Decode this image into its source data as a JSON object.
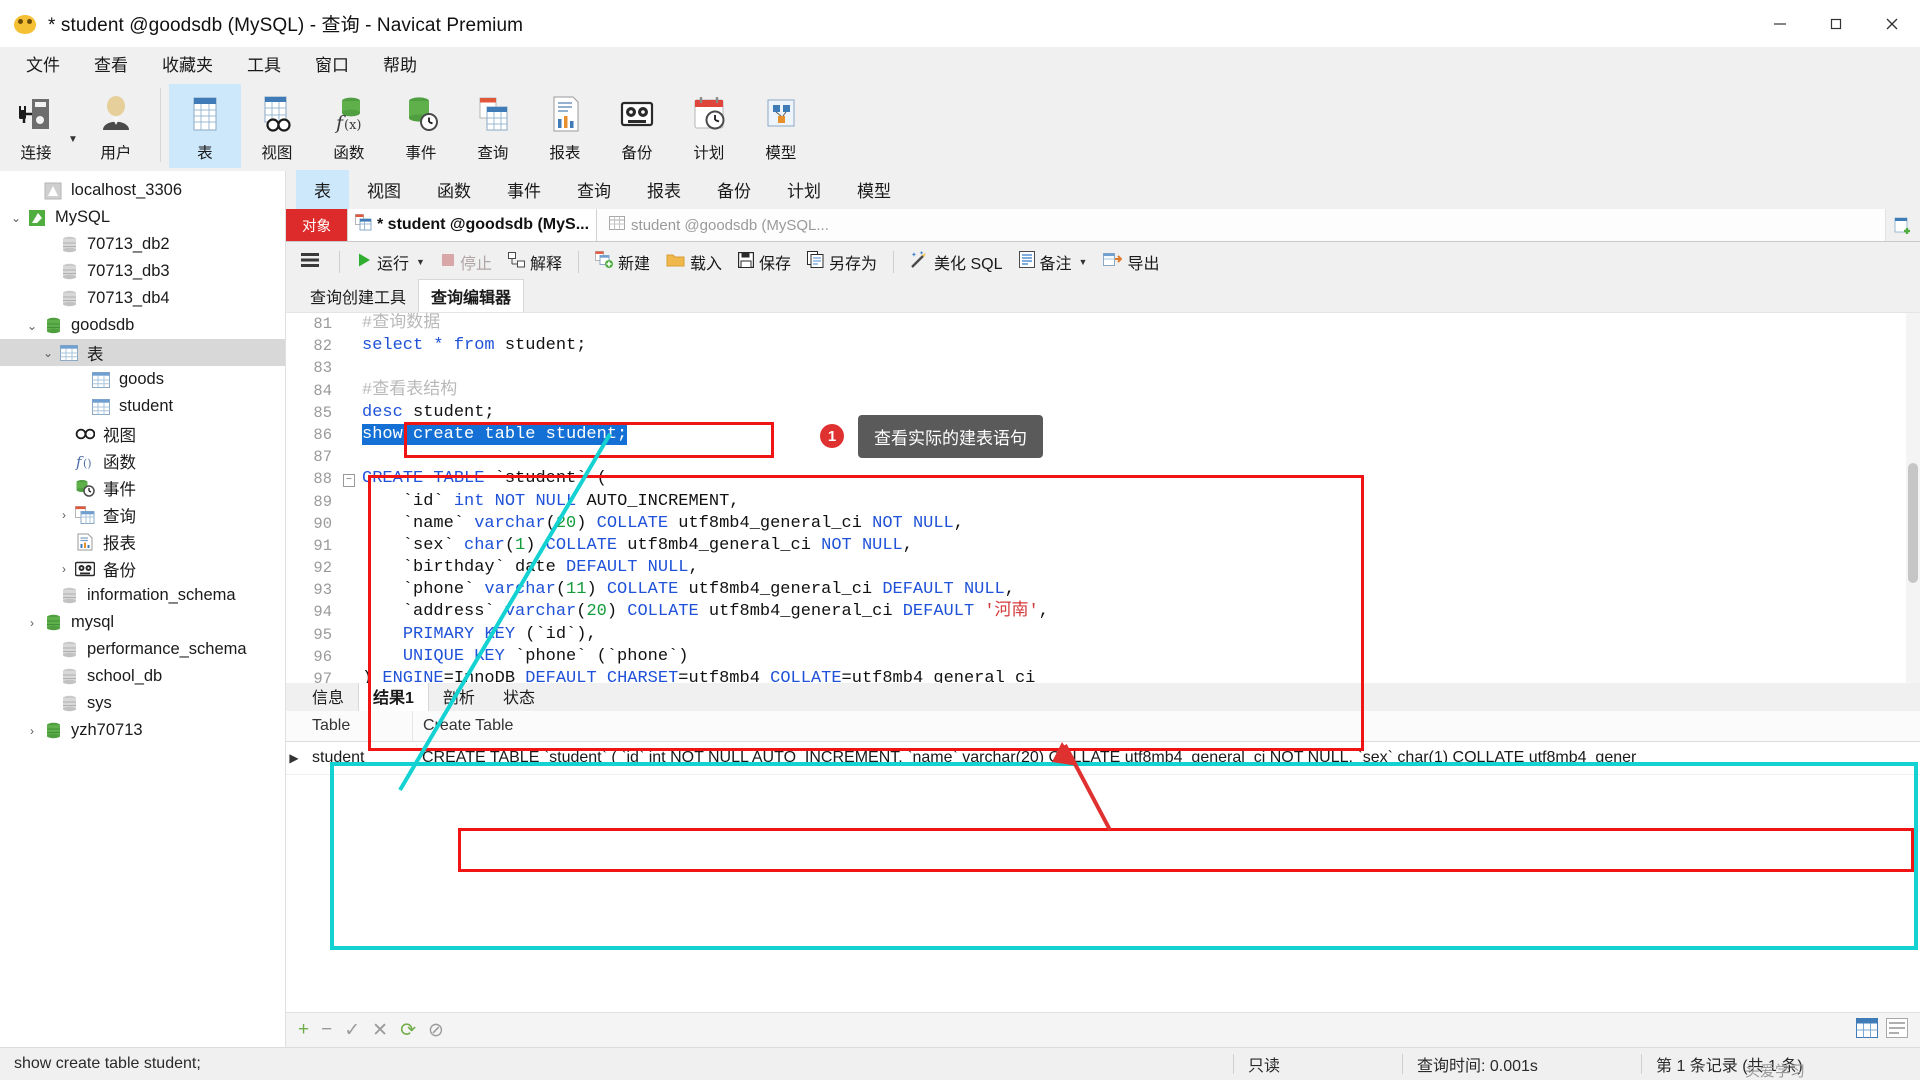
{
  "window": {
    "title": "* student @goodsdb (MySQL) - 查询 - Navicat Premium",
    "app_icon": "navicat-logo-icon",
    "minimize": "minimize-icon",
    "maximize": "maximize-icon",
    "close": "close-icon"
  },
  "menu": {
    "items": [
      "文件",
      "查看",
      "收藏夹",
      "工具",
      "窗口",
      "帮助"
    ]
  },
  "ribbon": {
    "left": [
      {
        "label": "连接",
        "icon": "connection-icon",
        "has_dropdown": true
      },
      {
        "label": "用户",
        "icon": "user-icon",
        "has_dropdown": false
      }
    ],
    "items": [
      {
        "label": "表",
        "icon": "table-icon",
        "selected": true
      },
      {
        "label": "视图",
        "icon": "view-icon",
        "selected": false
      },
      {
        "label": "函数",
        "icon": "function-icon",
        "selected": false
      },
      {
        "label": "事件",
        "icon": "event-icon",
        "selected": false
      },
      {
        "label": "查询",
        "icon": "query-icon",
        "selected": false
      },
      {
        "label": "报表",
        "icon": "report-icon",
        "selected": false
      },
      {
        "label": "备份",
        "icon": "backup-icon",
        "selected": false
      },
      {
        "label": "计划",
        "icon": "schedule-icon",
        "selected": false
      },
      {
        "label": "模型",
        "icon": "model-icon",
        "selected": false
      }
    ]
  },
  "sidebar": {
    "items": [
      {
        "label": "localhost_3306",
        "icon": "connection-gray-icon",
        "indent": 1,
        "twisty": "",
        "selected": false
      },
      {
        "label": "MySQL",
        "icon": "connection-green-icon",
        "indent": 0,
        "twisty": "open",
        "selected": false
      },
      {
        "label": "70713_db2",
        "icon": "database-gray-icon",
        "indent": 2,
        "twisty": "",
        "selected": false
      },
      {
        "label": "70713_db3",
        "icon": "database-gray-icon",
        "indent": 2,
        "twisty": "",
        "selected": false
      },
      {
        "label": "70713_db4",
        "icon": "database-gray-icon",
        "indent": 2,
        "twisty": "",
        "selected": false
      },
      {
        "label": "goodsdb",
        "icon": "database-green-icon",
        "indent": 1,
        "twisty": "open",
        "selected": false
      },
      {
        "label": "表",
        "icon": "table-folder-icon",
        "indent": 2,
        "twisty": "open",
        "selected": true
      },
      {
        "label": "goods",
        "icon": "table-icon",
        "indent": 4,
        "twisty": "",
        "selected": false
      },
      {
        "label": "student",
        "icon": "table-icon",
        "indent": 4,
        "twisty": "",
        "selected": false
      },
      {
        "label": "视图",
        "icon": "view-icon",
        "indent": 3,
        "twisty": "",
        "selected": false
      },
      {
        "label": "函数",
        "icon": "function-icon",
        "indent": 3,
        "twisty": "",
        "selected": false
      },
      {
        "label": "事件",
        "icon": "event-icon",
        "indent": 3,
        "twisty": "",
        "selected": false
      },
      {
        "label": "查询",
        "icon": "query-icon",
        "indent": 3,
        "twisty": "closed",
        "selected": false
      },
      {
        "label": "报表",
        "icon": "report-icon",
        "indent": 3,
        "twisty": "",
        "selected": false
      },
      {
        "label": "备份",
        "icon": "backup-icon",
        "indent": 3,
        "twisty": "closed",
        "selected": false
      },
      {
        "label": "information_schema",
        "icon": "database-gray-icon",
        "indent": 2,
        "twisty": "",
        "selected": false
      },
      {
        "label": "mysql",
        "icon": "database-green-icon",
        "indent": 1,
        "twisty": "closed",
        "selected": false
      },
      {
        "label": "performance_schema",
        "icon": "database-gray-icon",
        "indent": 2,
        "twisty": "",
        "selected": false
      },
      {
        "label": "school_db",
        "icon": "database-gray-icon",
        "indent": 2,
        "twisty": "",
        "selected": false
      },
      {
        "label": "sys",
        "icon": "database-gray-icon",
        "indent": 2,
        "twisty": "",
        "selected": false
      },
      {
        "label": "yzh70713",
        "icon": "database-green-icon",
        "indent": 1,
        "twisty": "closed",
        "selected": false
      }
    ]
  },
  "object_tabs": {
    "badge": "对象",
    "active": "* student @goodsdb (MyS...",
    "inactive": "student @goodsdb (MySQL...",
    "add_label": "新建标签"
  },
  "action_toolbar": {
    "menu_icon": "hamburger-icon",
    "items": [
      {
        "label": "运行",
        "icon": "run-icon",
        "disabled": false,
        "dropdown": true
      },
      {
        "label": "停止",
        "icon": "stop-icon",
        "disabled": true,
        "dropdown": false
      },
      {
        "label": "解释",
        "icon": "explain-icon",
        "disabled": false,
        "dropdown": false
      },
      {
        "label": "新建",
        "icon": "new-icon",
        "disabled": false,
        "dropdown": false
      },
      {
        "label": "载入",
        "icon": "load-icon",
        "disabled": false,
        "dropdown": false
      },
      {
        "label": "保存",
        "icon": "save-icon",
        "disabled": false,
        "dropdown": false
      },
      {
        "label": "另存为",
        "icon": "save-as-icon",
        "disabled": false,
        "dropdown": false
      },
      {
        "label": "美化 SQL",
        "icon": "beautify-icon",
        "disabled": false,
        "dropdown": false
      },
      {
        "label": "备注",
        "icon": "comment-icon",
        "disabled": false,
        "dropdown": true
      },
      {
        "label": "导出",
        "icon": "export-icon",
        "disabled": false,
        "dropdown": false
      }
    ]
  },
  "editor_tabs": {
    "items": [
      {
        "label": "查询创建工具",
        "selected": false
      },
      {
        "label": "查询编辑器",
        "selected": true
      }
    ]
  },
  "editor": {
    "lines": [
      {
        "n": "81",
        "fold": "",
        "tokens": [
          {
            "t": "#查询数据",
            "c": "cm"
          }
        ]
      },
      {
        "n": "82",
        "fold": "",
        "tokens": [
          {
            "t": "select",
            "c": "k"
          },
          {
            "t": " * ",
            "c": "k"
          },
          {
            "t": "from",
            "c": "k"
          },
          {
            "t": " student;",
            "c": "pl"
          }
        ]
      },
      {
        "n": "83",
        "fold": "",
        "tokens": []
      },
      {
        "n": "84",
        "fold": "",
        "tokens": [
          {
            "t": "#查看表结构",
            "c": "cm"
          }
        ]
      },
      {
        "n": "85",
        "fold": "",
        "tokens": [
          {
            "t": "desc",
            "c": "k"
          },
          {
            "t": " student;",
            "c": "pl"
          }
        ]
      },
      {
        "n": "86",
        "fold": "",
        "selected": true,
        "tokens": [
          {
            "t": "show create table student;",
            "c": "pl"
          }
        ]
      },
      {
        "n": "87",
        "fold": "",
        "tokens": []
      },
      {
        "n": "88",
        "fold": "-",
        "tokens": [
          {
            "t": "CREATE",
            "c": "k"
          },
          {
            "t": " ",
            "c": "pl"
          },
          {
            "t": "TABLE",
            "c": "k"
          },
          {
            "t": " `student` (",
            "c": "pl"
          }
        ]
      },
      {
        "n": "89",
        "fold": "",
        "tokens": [
          {
            "t": "    `id` ",
            "c": "pl"
          },
          {
            "t": "int",
            "c": "k"
          },
          {
            "t": " ",
            "c": "pl"
          },
          {
            "t": "NOT",
            "c": "k"
          },
          {
            "t": " ",
            "c": "pl"
          },
          {
            "t": "NULL",
            "c": "k"
          },
          {
            "t": " AUTO_INCREMENT,",
            "c": "pl"
          }
        ]
      },
      {
        "n": "90",
        "fold": "",
        "tokens": [
          {
            "t": "    `name` ",
            "c": "pl"
          },
          {
            "t": "varchar",
            "c": "k"
          },
          {
            "t": "(",
            "c": "pl"
          },
          {
            "t": "20",
            "c": "num"
          },
          {
            "t": ") ",
            "c": "pl"
          },
          {
            "t": "COLLATE",
            "c": "k"
          },
          {
            "t": " utf8mb4_general_ci ",
            "c": "pl"
          },
          {
            "t": "NOT",
            "c": "k"
          },
          {
            "t": " ",
            "c": "pl"
          },
          {
            "t": "NULL",
            "c": "k"
          },
          {
            "t": ",",
            "c": "pl"
          }
        ]
      },
      {
        "n": "91",
        "fold": "",
        "tokens": [
          {
            "t": "    `sex` ",
            "c": "pl"
          },
          {
            "t": "char",
            "c": "k"
          },
          {
            "t": "(",
            "c": "pl"
          },
          {
            "t": "1",
            "c": "num"
          },
          {
            "t": ") ",
            "c": "pl"
          },
          {
            "t": "COLLATE",
            "c": "k"
          },
          {
            "t": " utf8mb4_general_ci ",
            "c": "pl"
          },
          {
            "t": "NOT",
            "c": "k"
          },
          {
            "t": " ",
            "c": "pl"
          },
          {
            "t": "NULL",
            "c": "k"
          },
          {
            "t": ",",
            "c": "pl"
          }
        ]
      },
      {
        "n": "92",
        "fold": "",
        "tokens": [
          {
            "t": "    `birthday` date ",
            "c": "pl"
          },
          {
            "t": "DEFAULT",
            "c": "k"
          },
          {
            "t": " ",
            "c": "pl"
          },
          {
            "t": "NULL",
            "c": "k"
          },
          {
            "t": ",",
            "c": "pl"
          }
        ]
      },
      {
        "n": "93",
        "fold": "",
        "tokens": [
          {
            "t": "    `phone` ",
            "c": "pl"
          },
          {
            "t": "varchar",
            "c": "k"
          },
          {
            "t": "(",
            "c": "pl"
          },
          {
            "t": "11",
            "c": "num"
          },
          {
            "t": ") ",
            "c": "pl"
          },
          {
            "t": "COLLATE",
            "c": "k"
          },
          {
            "t": " utf8mb4_general_ci ",
            "c": "pl"
          },
          {
            "t": "DEFAULT",
            "c": "k"
          },
          {
            "t": " ",
            "c": "pl"
          },
          {
            "t": "NULL",
            "c": "k"
          },
          {
            "t": ",",
            "c": "pl"
          }
        ]
      },
      {
        "n": "94",
        "fold": "",
        "tokens": [
          {
            "t": "    `address` ",
            "c": "pl"
          },
          {
            "t": "varchar",
            "c": "k"
          },
          {
            "t": "(",
            "c": "pl"
          },
          {
            "t": "20",
            "c": "num"
          },
          {
            "t": ") ",
            "c": "pl"
          },
          {
            "t": "COLLATE",
            "c": "k"
          },
          {
            "t": " utf8mb4_general_ci ",
            "c": "pl"
          },
          {
            "t": "DEFAULT",
            "c": "k"
          },
          {
            "t": " ",
            "c": "pl"
          },
          {
            "t": "'河南'",
            "c": "str"
          },
          {
            "t": ",",
            "c": "pl"
          }
        ]
      },
      {
        "n": "95",
        "fold": "",
        "tokens": [
          {
            "t": "    ",
            "c": "pl"
          },
          {
            "t": "PRIMARY",
            "c": "k"
          },
          {
            "t": " ",
            "c": "pl"
          },
          {
            "t": "KEY",
            "c": "k"
          },
          {
            "t": " (`id`),",
            "c": "pl"
          }
        ]
      },
      {
        "n": "96",
        "fold": "",
        "tokens": [
          {
            "t": "    ",
            "c": "pl"
          },
          {
            "t": "UNIQUE",
            "c": "k"
          },
          {
            "t": " ",
            "c": "pl"
          },
          {
            "t": "KEY",
            "c": "k"
          },
          {
            "t": " `phone` (`phone`)",
            "c": "pl"
          }
        ]
      },
      {
        "n": "97",
        "fold": "",
        "tokens": [
          {
            "t": ") ",
            "c": "pl"
          },
          {
            "t": "ENGINE",
            "c": "k"
          },
          {
            "t": "=InnoDB ",
            "c": "pl"
          },
          {
            "t": "DEFAULT",
            "c": "k"
          },
          {
            "t": " ",
            "c": "pl"
          },
          {
            "t": "CHARSET",
            "c": "k"
          },
          {
            "t": "=utf8mb4 ",
            "c": "pl"
          },
          {
            "t": "COLLATE",
            "c": "k"
          },
          {
            "t": "=utf8mb4_general_ci",
            "c": "pl"
          }
        ]
      }
    ]
  },
  "annotation": {
    "badge_number": "1",
    "tooltip": "查看实际的建表语句"
  },
  "result_tabs": {
    "items": [
      {
        "label": "信息",
        "selected": false
      },
      {
        "label": "结果1",
        "selected": true
      },
      {
        "label": "剖析",
        "selected": false
      },
      {
        "label": "状态",
        "selected": false
      }
    ]
  },
  "result_grid": {
    "columns": [
      "Table",
      "Create Table"
    ],
    "rows": [
      {
        "marker": "▶",
        "Table": "student",
        "Create Table": "CREATE TABLE `student` (  `id` int NOT NULL AUTO_INCREMENT,  `name` varchar(20) COLLATE utf8mb4_general_ci NOT NULL,  `sex` char(1) COLLATE utf8mb4_gener"
      }
    ]
  },
  "grid_footer": {
    "buttons": [
      {
        "icon": "plus-icon",
        "label": "+"
      },
      {
        "icon": "minus-icon",
        "label": "−"
      },
      {
        "icon": "check-icon",
        "label": "✓"
      },
      {
        "icon": "cancel-icon",
        "label": "✕"
      },
      {
        "icon": "refresh-icon",
        "label": "⟳"
      },
      {
        "icon": "stop-circle-icon",
        "label": "⊘"
      }
    ],
    "view_icons": [
      {
        "icon": "grid-view-icon"
      },
      {
        "icon": "form-view-icon"
      }
    ]
  },
  "status_bar": {
    "sql": "show create table student;",
    "readonly": "只读",
    "time_label": "查询时间: 0.001s",
    "record_info": "第 1 条记录 (共 1 条)",
    "watermark": "头爱学习"
  }
}
